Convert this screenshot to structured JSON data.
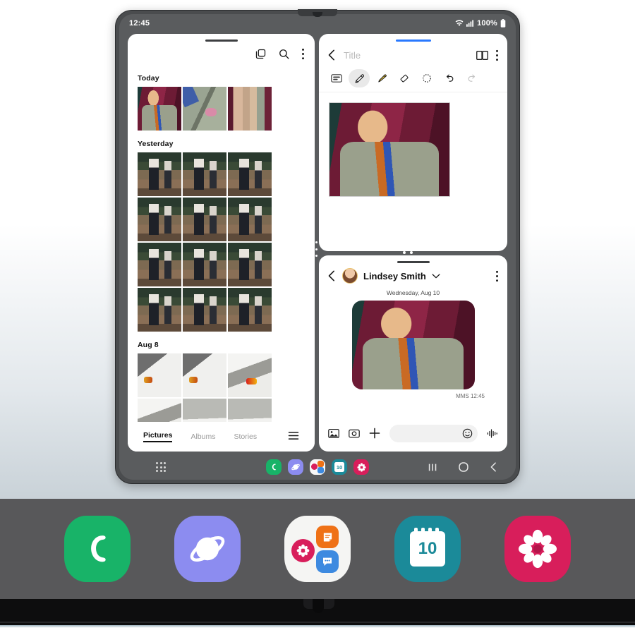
{
  "status_bar": {
    "time": "12:45",
    "battery_label": "100%",
    "icons": [
      "wifi-icon",
      "signal-icon",
      "battery-icon"
    ]
  },
  "gallery": {
    "header_icons": [
      "multi-select-icon",
      "search-icon",
      "more-options-icon"
    ],
    "sections": [
      {
        "title": "Today",
        "columns": 3,
        "photos": [
          {
            "alt": "suit-on-mannequin",
            "style": "img-suit"
          },
          {
            "alt": "suit-lapel-pocket-square",
            "style": "img-lapel"
          },
          {
            "alt": "hanging-jacket-sleeves",
            "style": "img-sleeves"
          }
        ]
      },
      {
        "title": "Yesterday",
        "columns": 4,
        "photos": [
          {
            "alt": "crowd-interior-1",
            "style": "img-crowd"
          },
          {
            "alt": "crowd-interior-2",
            "style": "img-crowd"
          },
          {
            "alt": "crowd-interior-3",
            "style": "img-crowd"
          },
          {
            "alt": "crowd-interior-4",
            "style": "img-crowd"
          },
          {
            "alt": "crowd-interior-5",
            "style": "img-crowd"
          },
          {
            "alt": "crowd-interior-6",
            "style": "img-crowd"
          },
          {
            "alt": "crowd-interior-7",
            "style": "img-crowd"
          },
          {
            "alt": "crowd-interior-8",
            "style": "img-crowd"
          },
          {
            "alt": "crowd-interior-9",
            "style": "img-crowd"
          },
          {
            "alt": "crowd-interior-10",
            "style": "img-crowd"
          },
          {
            "alt": "crowd-interior-11",
            "style": "img-crowd"
          },
          {
            "alt": "crowd-interior-12",
            "style": "img-crowd"
          }
        ]
      },
      {
        "title": "Aug 8",
        "columns": 4,
        "photos": [
          {
            "alt": "white-chair-dark-1",
            "style": "img-chair"
          },
          {
            "alt": "white-chair-dark-2",
            "style": "img-chair"
          },
          {
            "alt": "white-chair-light-1",
            "style": "img-chair2"
          },
          {
            "alt": "white-chair-light-2",
            "style": "img-chair2"
          },
          {
            "alt": "white-chair-plain-1",
            "style": "img-chair3"
          },
          {
            "alt": "white-chair-plain-2",
            "style": "img-chair3"
          }
        ]
      }
    ],
    "tabs": [
      {
        "label": "Pictures",
        "active": true
      },
      {
        "label": "Albums",
        "active": false
      },
      {
        "label": "Stories",
        "active": false
      }
    ],
    "menu_icon": "hamburger-icon"
  },
  "notes": {
    "back_icon": "back-arrow-icon",
    "title_placeholder": "Title",
    "title_value": "",
    "header_icons": [
      "reading-mode-icon",
      "more-options-icon"
    ],
    "tools": [
      {
        "name": "text-mode-icon",
        "selected": false
      },
      {
        "name": "pen-icon",
        "selected": true
      },
      {
        "name": "highlighter-icon",
        "selected": false
      },
      {
        "name": "eraser-icon",
        "selected": false
      },
      {
        "name": "lasso-select-icon",
        "selected": false
      },
      {
        "name": "undo-icon",
        "selected": false
      },
      {
        "name": "redo-icon",
        "selected": false
      }
    ],
    "canvas_photo_alt": "suit-on-mannequin-note"
  },
  "messages": {
    "back_icon": "back-arrow-icon",
    "contact_name": "Lindsey Smith",
    "chevron_icon": "chevron-down-icon",
    "more_icon": "more-options-icon",
    "date_separator": "Wednesday, Aug 10",
    "bubble_photo_alt": "suit-on-mannequin-mms",
    "message_meta": "MMS 12:45",
    "input_placeholder": "",
    "input_value": "",
    "input_icons": [
      "gallery-icon",
      "camera-icon",
      "plus-icon",
      "emoji-icon",
      "voice-record-icon"
    ]
  },
  "taskbar": {
    "apps_button": "app-drawer-icon",
    "dock_apps": [
      {
        "name": "phone",
        "color": "#18b368"
      },
      {
        "name": "internet",
        "color": "#8c8cf0"
      },
      {
        "name": "app-folder",
        "color": "#ffffff"
      },
      {
        "name": "calendar",
        "color": "#1b8a99",
        "badge": "10"
      },
      {
        "name": "gallery",
        "color": "#d81e5b"
      }
    ],
    "nav_buttons": [
      "recents-icon",
      "home-icon",
      "back-icon"
    ]
  },
  "zoom_callout": {
    "apps": [
      {
        "name": "phone",
        "color": "#18b368"
      },
      {
        "name": "internet",
        "color": "#8c8cf0"
      },
      {
        "name": "app-folder",
        "color": "#ffffff"
      },
      {
        "name": "calendar",
        "color": "#1b8a99",
        "badge": "10"
      },
      {
        "name": "gallery",
        "color": "#d81e5b"
      }
    ]
  }
}
